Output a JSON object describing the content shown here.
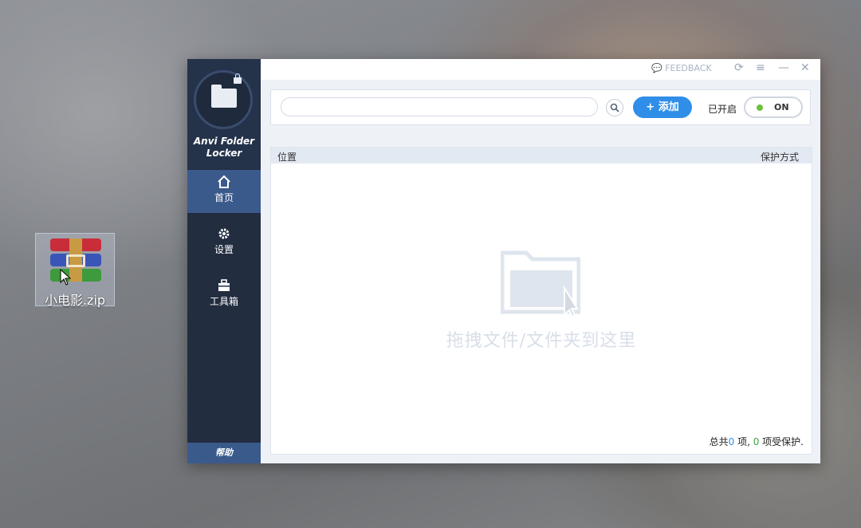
{
  "desktop": {
    "file_label": "小电影.zip"
  },
  "sidebar": {
    "app_name_line1": "Anvi Folder",
    "app_name_line2": "Locker",
    "items": [
      {
        "label": "首页",
        "icon": "home-icon",
        "active": true
      },
      {
        "label": "设置",
        "icon": "gear-icon",
        "active": false
      },
      {
        "label": "工具箱",
        "icon": "toolbox-icon",
        "active": false
      }
    ],
    "help_label": "帮助"
  },
  "titlebar": {
    "feedback_label": "FEEDBACK"
  },
  "toolbar": {
    "search_value": "",
    "add_label": "添加",
    "status_label": "已开启",
    "toggle_label": "ON"
  },
  "list": {
    "col_location": "位置",
    "col_protection": "保护方式",
    "empty_text": "拖拽文件/文件夹到这里",
    "summary_prefix": "总共",
    "total": "0",
    "summary_mid": " 项, ",
    "protected": "0",
    "summary_suffix": " 项受保护."
  },
  "colors": {
    "accent": "#2f8ee8",
    "sidebar": "#222d40",
    "active": "#3b5a8c",
    "on": "#6dc23a"
  }
}
